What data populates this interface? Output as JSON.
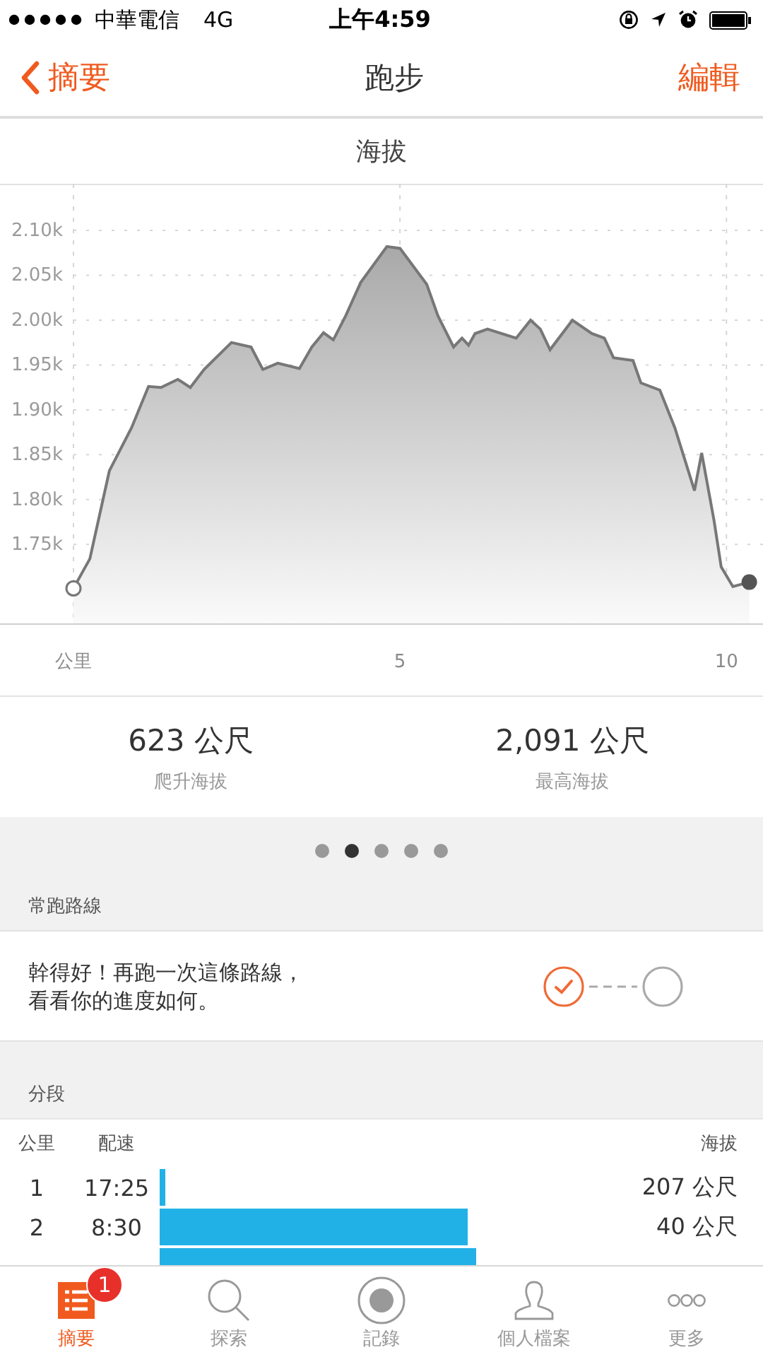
{
  "status_bar": {
    "carrier": "中華電信",
    "network": "4G",
    "time": "上午4:59"
  },
  "nav": {
    "back": "摘要",
    "title": "跑步",
    "action": "編輯"
  },
  "chart_section": {
    "title": "海拔",
    "chart_data": {
      "type": "area",
      "x": [
        0,
        0.25,
        0.55,
        0.89,
        1.15,
        1.34,
        1.6,
        1.79,
        2.0,
        2.42,
        2.72,
        2.9,
        3.13,
        3.46,
        3.65,
        3.83,
        3.98,
        4.17,
        4.4,
        4.8,
        5.0,
        5.41,
        5.58,
        5.82,
        5.95,
        6.05,
        6.15,
        6.34,
        6.78,
        7.0,
        7.15,
        7.3,
        7.64,
        7.94,
        8.13,
        8.27,
        8.57,
        8.69,
        8.98,
        9.21,
        9.51,
        9.62,
        9.81,
        9.92,
        10.1,
        10.35
      ],
      "grid": true,
      "series": [
        {
          "color": "#777777",
          "values": [
            1.701,
            1.734,
            1.832,
            1.88,
            1.926,
            1.925,
            1.934,
            1.925,
            1.945,
            1.975,
            1.97,
            1.945,
            1.952,
            1.946,
            1.97,
            1.986,
            1.978,
            2.005,
            2.042,
            2.082,
            2.08,
            2.04,
            2.005,
            1.97,
            1.98,
            1.972,
            1.985,
            1.99,
            1.98,
            2.0,
            1.99,
            1.967,
            2.0,
            1.985,
            1.98,
            1.958,
            1.955,
            1.93,
            1.922,
            1.88,
            1.81,
            1.852,
            1.777,
            1.725,
            1.703,
            1.708
          ]
        }
      ],
      "xlim": [
        0,
        10.56
      ],
      "ylim": [
        1.662,
        2.152
      ],
      "xticks": [
        {
          "value": 0,
          "label": "公里"
        },
        {
          "value": 5,
          "label": "5"
        },
        {
          "value": 10,
          "label": "10"
        }
      ],
      "yticks": [
        {
          "value": 1.75,
          "label": "1.75k"
        },
        {
          "value": 1.8,
          "label": "1.80k"
        },
        {
          "value": 1.85,
          "label": "1.85k"
        },
        {
          "value": 1.9,
          "label": "1.90k"
        },
        {
          "value": 1.95,
          "label": "1.95k"
        },
        {
          "value": 2.0,
          "label": "2.00k"
        },
        {
          "value": 2.05,
          "label": "2.05k"
        },
        {
          "value": 2.1,
          "label": "2.10k"
        }
      ]
    }
  },
  "stats": [
    {
      "value": "623 公尺",
      "label": "爬升海拔"
    },
    {
      "value": "2,091 公尺",
      "label": "最高海拔"
    }
  ],
  "page_dots": [
    {
      "selected": false
    },
    {
      "selected": true
    },
    {
      "selected": false
    },
    {
      "selected": false
    },
    {
      "selected": false
    }
  ],
  "route_section": {
    "title": "常跑路線",
    "message": "幹得好！再跑一次這條路線，看看你的進度如何。",
    "progress": [
      {
        "completed": true
      },
      {
        "completed": false
      }
    ]
  },
  "splits": {
    "title": "分段",
    "columns": [
      "公里",
      "配速",
      "海拔"
    ],
    "rows": [
      {
        "km": "1",
        "pace": "17:25",
        "elevation": "207 公尺"
      },
      {
        "km": "2",
        "pace": "8:30",
        "elevation": "40 公尺"
      }
    ]
  },
  "tab_bar": [
    {
      "kind": "summary",
      "label": "摘要",
      "selected": true,
      "badge": "1"
    },
    {
      "kind": "explore",
      "label": "探索",
      "selected": false
    },
    {
      "kind": "record",
      "label": "記錄",
      "selected": false
    },
    {
      "kind": "profile",
      "label": "個人檔案",
      "selected": false
    },
    {
      "kind": "more",
      "label": "更多",
      "selected": false
    }
  ]
}
